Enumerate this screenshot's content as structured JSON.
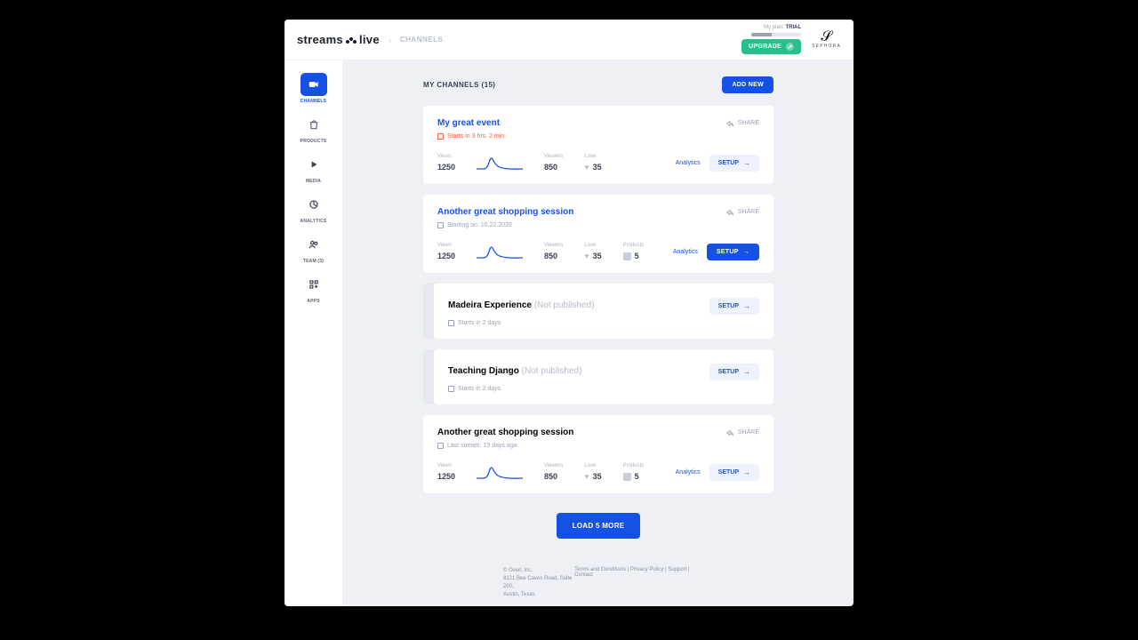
{
  "header": {
    "logo_a": "streams",
    "logo_b": "live",
    "breadcrumb": "CHANNELS",
    "plan_prefix": "My plan:",
    "plan_name": "TRIAL",
    "upgrade": "UPGRADE",
    "brand": "SEPHORA"
  },
  "sidebar": {
    "items": [
      {
        "label": "CHANNELS"
      },
      {
        "label": "PRODUCTS"
      },
      {
        "label": "MEDIA"
      },
      {
        "label": "ANALYTICS"
      },
      {
        "label": "TEAM (3)"
      },
      {
        "label": "APPS"
      }
    ]
  },
  "page": {
    "title": "MY CHANNELS (15)",
    "add_new": "ADD NEW",
    "load_more": "LOAD 5 MORE"
  },
  "labels": {
    "share": "SHARE",
    "analytics": "Analytics",
    "setup": "SETUP",
    "views": "Views",
    "viewers": "Viewers",
    "love": "Love",
    "products": "Products"
  },
  "cards": [
    {
      "title": "My great event",
      "subtitle": "Starts in 3 hrs. 2 min",
      "views": "1250",
      "viewers": "850",
      "love": "35"
    },
    {
      "title": "Another great shopping session",
      "subtitle": "Starting on: 10.22.2020",
      "views": "1250",
      "viewers": "850",
      "love": "35",
      "products": "5"
    },
    {
      "title": "Madeira Experience",
      "status": "(Not published)",
      "subtitle": "Starts in 2 days"
    },
    {
      "title": "Teaching Django",
      "status": "(Not published)",
      "subtitle": "Starts in 2 days"
    },
    {
      "title": "Another great shopping session",
      "subtitle": "Last stream: 15 days ago",
      "views": "1250",
      "viewers": "850",
      "love": "35",
      "products": "5"
    }
  ],
  "footer": {
    "line1": "© Oveit, Inc.",
    "line2": "8121 Bee Caves Road, Suite 200,",
    "line3": "Austin, Texas",
    "links": [
      "Terms and Conditions",
      "Privacy Policy",
      "Support",
      "Contact"
    ]
  }
}
